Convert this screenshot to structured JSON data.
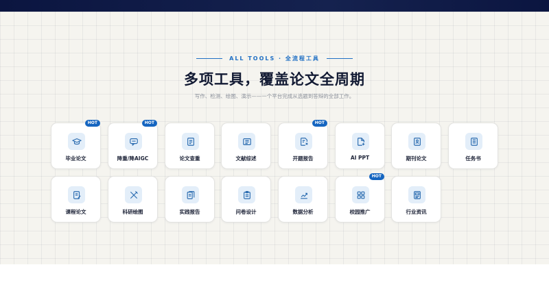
{
  "header": {
    "kicker": "ALL TOOLS · 全流程工具",
    "title": "多项工具，覆盖论文全周期",
    "subtitle": "写作、检测、绘图、演示——一个平台完成从选题到答辩的全部工作。"
  },
  "badge_label": "HOT",
  "colors": {
    "accent": "#1f6fc4",
    "icon_bg": "#e3eef9",
    "hot_badge": "#1565c0",
    "topbar": "#0b1540"
  },
  "tools": [
    {
      "label": "毕业论文",
      "icon": "graduation-cap-icon",
      "hot": true
    },
    {
      "label": "降重/降AIGC",
      "icon": "chat-bubble-icon",
      "hot": true
    },
    {
      "label": "论文查重",
      "icon": "document-check-icon",
      "hot": false
    },
    {
      "label": "文献综述",
      "icon": "list-document-icon",
      "hot": false
    },
    {
      "label": "开题报告",
      "icon": "document-edit-icon",
      "hot": true
    },
    {
      "label": "AI PPT",
      "icon": "presentation-file-icon",
      "hot": false
    },
    {
      "label": "期刊论文",
      "icon": "journal-icon",
      "hot": false
    },
    {
      "label": "任务书",
      "icon": "task-book-icon",
      "hot": false
    },
    {
      "label": "课程论文",
      "icon": "course-paper-icon",
      "hot": false
    },
    {
      "label": "科研绘图",
      "icon": "drawing-tools-icon",
      "hot": false
    },
    {
      "label": "实践报告",
      "icon": "report-icon",
      "hot": false
    },
    {
      "label": "问卷设计",
      "icon": "survey-icon",
      "hot": false
    },
    {
      "label": "数据分析",
      "icon": "chart-icon",
      "hot": false
    },
    {
      "label": "校园推广",
      "icon": "grid-apps-icon",
      "hot": true
    },
    {
      "label": "行业资讯",
      "icon": "news-icon",
      "hot": false
    }
  ]
}
